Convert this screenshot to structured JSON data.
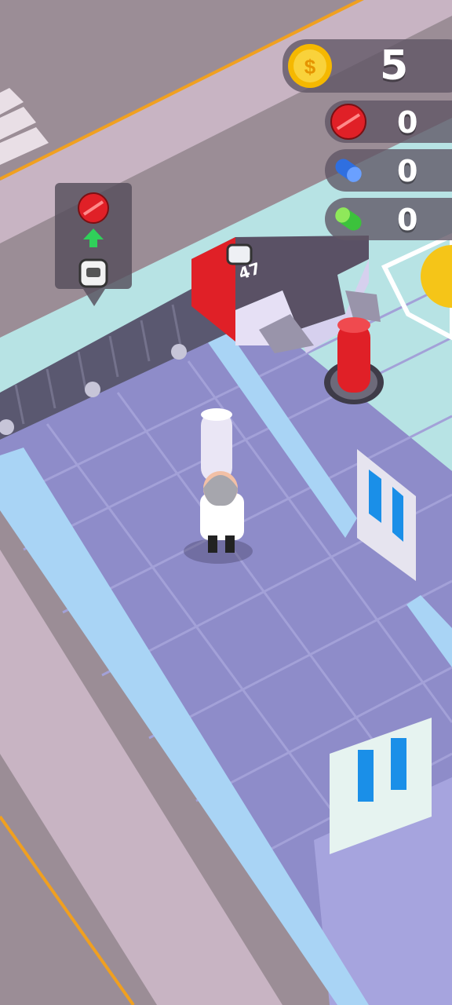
{
  "hud": {
    "coins": "5",
    "red_pills": "0",
    "blue_pills": "0",
    "green_pills": "0"
  },
  "machine": {
    "jar_count": "47"
  },
  "tooltip": {
    "input_icon": "red-pill-icon",
    "arrow_icon": "green-up-arrow-icon",
    "output_icon": "jar-icon"
  },
  "colors": {
    "coin": "#f5c518",
    "red_pill": "#e02027",
    "blue_pill": "#2f6fe0",
    "green_pill": "#3cc23c",
    "floor": "#8e8cc9",
    "wall": "#a9d4f5"
  }
}
